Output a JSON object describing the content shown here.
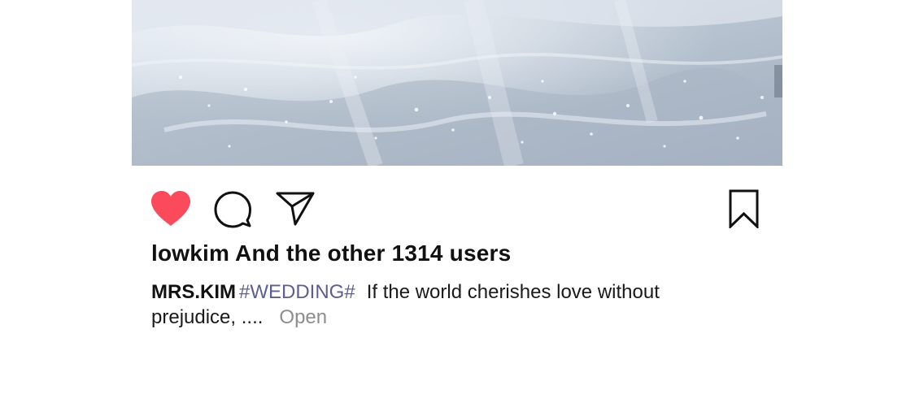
{
  "post": {
    "likes_text": "lowkim And the other 1314 users",
    "caption": {
      "author": "MRS.KIM",
      "hashtag": "#WEDDING#",
      "text": "If the world cherishes love without prejudice, ....",
      "more_label": "Open"
    },
    "icons": {
      "like": "heart-icon",
      "comment": "comment-bubble-icon",
      "share": "send-paper-plane-icon",
      "save": "bookmark-icon"
    },
    "colors": {
      "like_active": "#fb4a5c",
      "hashtag": "#5d5f8e",
      "more_link": "#8d8d8d",
      "text": "#111111"
    },
    "liked": true
  }
}
